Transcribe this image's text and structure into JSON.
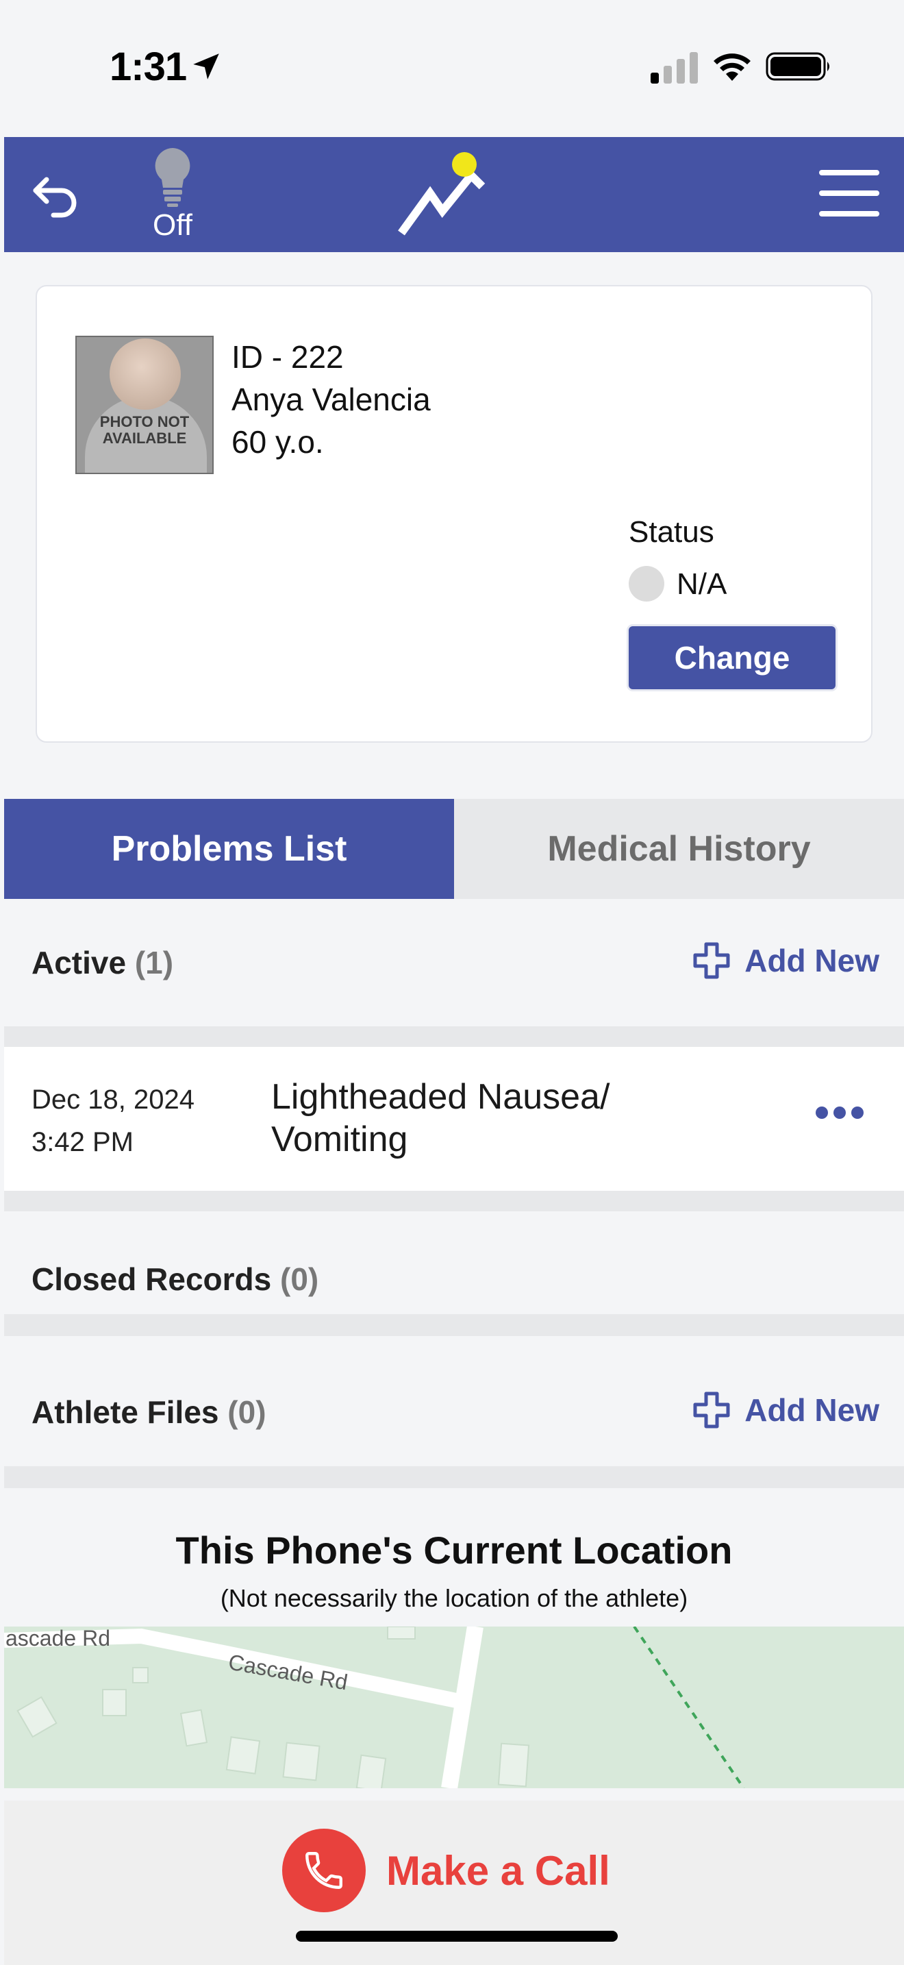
{
  "status_bar": {
    "time": "1:31"
  },
  "app_bar": {
    "light_label": "Off",
    "brand_color": "#4553a4",
    "accent_color": "#f1e61a"
  },
  "profile": {
    "photo_text": "PHOTO NOT AVAILABLE",
    "id_line": "ID - 222",
    "name": "Anya Valencia",
    "age": "60 y.o.",
    "status_label": "Status",
    "status_value": "N/A",
    "change_label": "Change"
  },
  "tabs": [
    {
      "label": "Problems List",
      "active": true
    },
    {
      "label": "Medical History",
      "active": false
    }
  ],
  "active_section": {
    "title": "Active",
    "count": "(1)",
    "add_label": "Add New"
  },
  "records": [
    {
      "date": "Dec 18, 2024",
      "time": "3:42 PM",
      "title": "Lightheaded Nausea/ Vomiting"
    }
  ],
  "closed_section": {
    "title": "Closed Records",
    "count": "(0)"
  },
  "files_section": {
    "title": "Athlete Files",
    "count": "(0)",
    "add_label": "Add New"
  },
  "location": {
    "title": "This Phone's Current Location",
    "subtitle": "(Not necessarily the location of the athlete)",
    "map_labels": [
      "ascade Rd",
      "Cascade Rd"
    ]
  },
  "call": {
    "label": "Make a Call",
    "color": "#e8413d"
  }
}
